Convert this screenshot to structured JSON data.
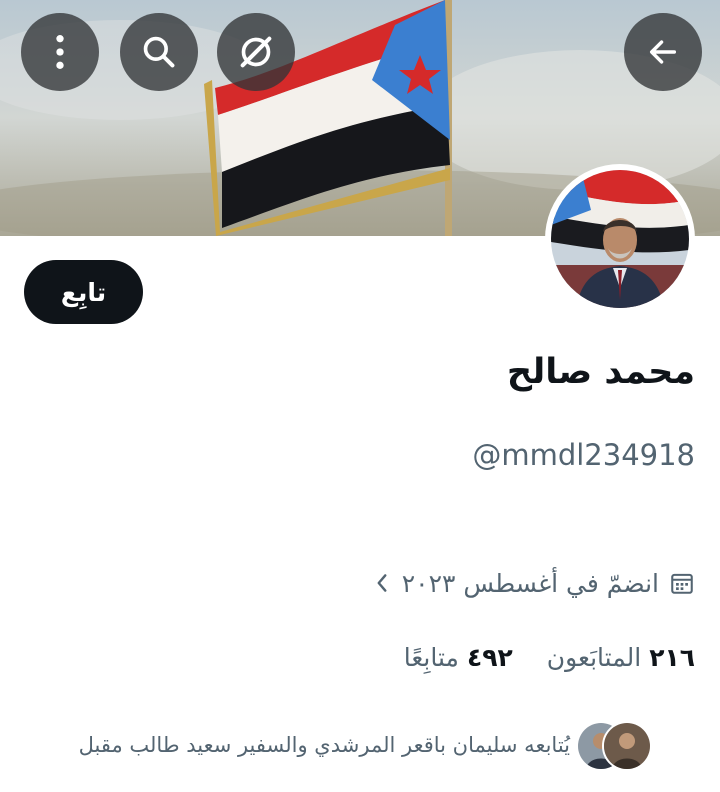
{
  "header": {
    "back_icon": "arrow-left-icon",
    "grok_icon": "grok-icon",
    "search_icon": "search-icon",
    "more_icon": "more-vertical-icon"
  },
  "profile": {
    "display_name": "محمد صالح",
    "handle": "@mmdl234918",
    "follow_label": "تابِع",
    "joined": "انضمّ في أغسطس ٢٠٢٣",
    "following_count": "٤٩٢",
    "following_label": "متابِعًا",
    "followers_count": "٢١٦",
    "followers_label": "المتابَعون",
    "followed_by": "يُتابعه سليمان باقعر المرشدي والسفير سعيد طالب مقبل"
  },
  "colors": {
    "text_primary": "#0f1419",
    "text_secondary": "#536471",
    "follow_bg": "#0f1419"
  }
}
